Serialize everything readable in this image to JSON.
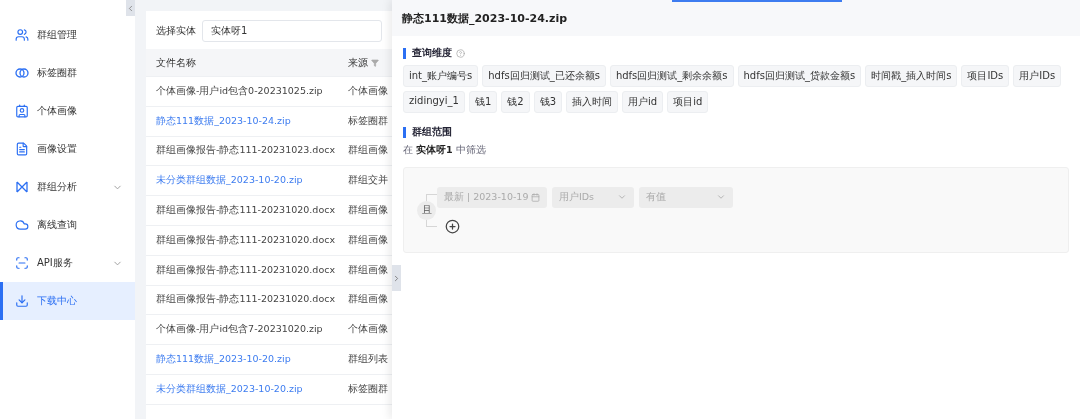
{
  "sidebar": {
    "items": [
      {
        "label": "群组管理",
        "kind": "link",
        "selected": false
      },
      {
        "label": "标签圈群",
        "kind": "link",
        "selected": false
      },
      {
        "label": "个体画像",
        "kind": "link",
        "selected": false
      },
      {
        "label": "画像设置",
        "kind": "link",
        "selected": false
      },
      {
        "label": "群组分析",
        "kind": "submenu",
        "expanded": false,
        "selected": false
      },
      {
        "label": "离线查询",
        "kind": "link",
        "selected": false
      },
      {
        "label": "API服务",
        "kind": "submenu",
        "expanded": false,
        "selected": false
      },
      {
        "label": "下载中心",
        "kind": "link",
        "selected": true
      }
    ]
  },
  "filter": {
    "label": "选择实体",
    "value": "实体呀1"
  },
  "table": {
    "columns": [
      "文件名称",
      "来源"
    ],
    "rows": [
      {
        "name": "个体画像-用户id包含0-20231025.zip",
        "source": "个体画像",
        "linked": false
      },
      {
        "name": "静态111数据_2023-10-24.zip",
        "source": "标签圈群",
        "linked": true
      },
      {
        "name": "群组画像报告-静态111-20231023.docx",
        "source": "群组画像",
        "linked": false
      },
      {
        "name": "未分类群组数据_2023-10-20.zip",
        "source": "群组交并",
        "linked": true
      },
      {
        "name": "群组画像报告-静态111-20231020.docx",
        "source": "群组画像",
        "linked": false
      },
      {
        "name": "群组画像报告-静态111-20231020.docx",
        "source": "群组画像",
        "linked": false
      },
      {
        "name": "群组画像报告-静态111-20231020.docx",
        "source": "群组画像",
        "linked": false
      },
      {
        "name": "群组画像报告-静态111-20231020.docx",
        "source": "群组画像",
        "linked": false
      },
      {
        "name": "个体画像-用户id包含7-20231020.zip",
        "source": "个体画像",
        "linked": false
      },
      {
        "name": "静态111数据_2023-10-20.zip",
        "source": "群组列表",
        "linked": true
      },
      {
        "name": "未分类群组数据_2023-10-20.zip",
        "source": "标签圈群",
        "linked": true
      }
    ]
  },
  "drawer": {
    "title": "静态111数据_2023-10-24.zip",
    "dimensions": {
      "title": "查询维度",
      "tags": [
        "int_账户编号s",
        "hdfs回归测试_已还余额s",
        "hdfs回归测试_剩余余额s",
        "hdfs回归测试_贷款金额s",
        "时间戳_插入时间s",
        "项目IDs",
        "用户IDs",
        "zidingyi_1",
        "钱1",
        "钱2",
        "钱3",
        "插入时间",
        "用户id",
        "项目id"
      ]
    },
    "scope": {
      "title": "群组范围",
      "note": "在 **实体呀1** 中筛选",
      "logic": "且",
      "conditions": [
        {
          "kind": "date",
          "value": "最新 | 2023-10-19",
          "disabled": true
        },
        {
          "kind": "select",
          "value": "用户IDs",
          "disabled": true
        },
        {
          "kind": "select",
          "value": "有值",
          "disabled": true
        }
      ]
    }
  }
}
